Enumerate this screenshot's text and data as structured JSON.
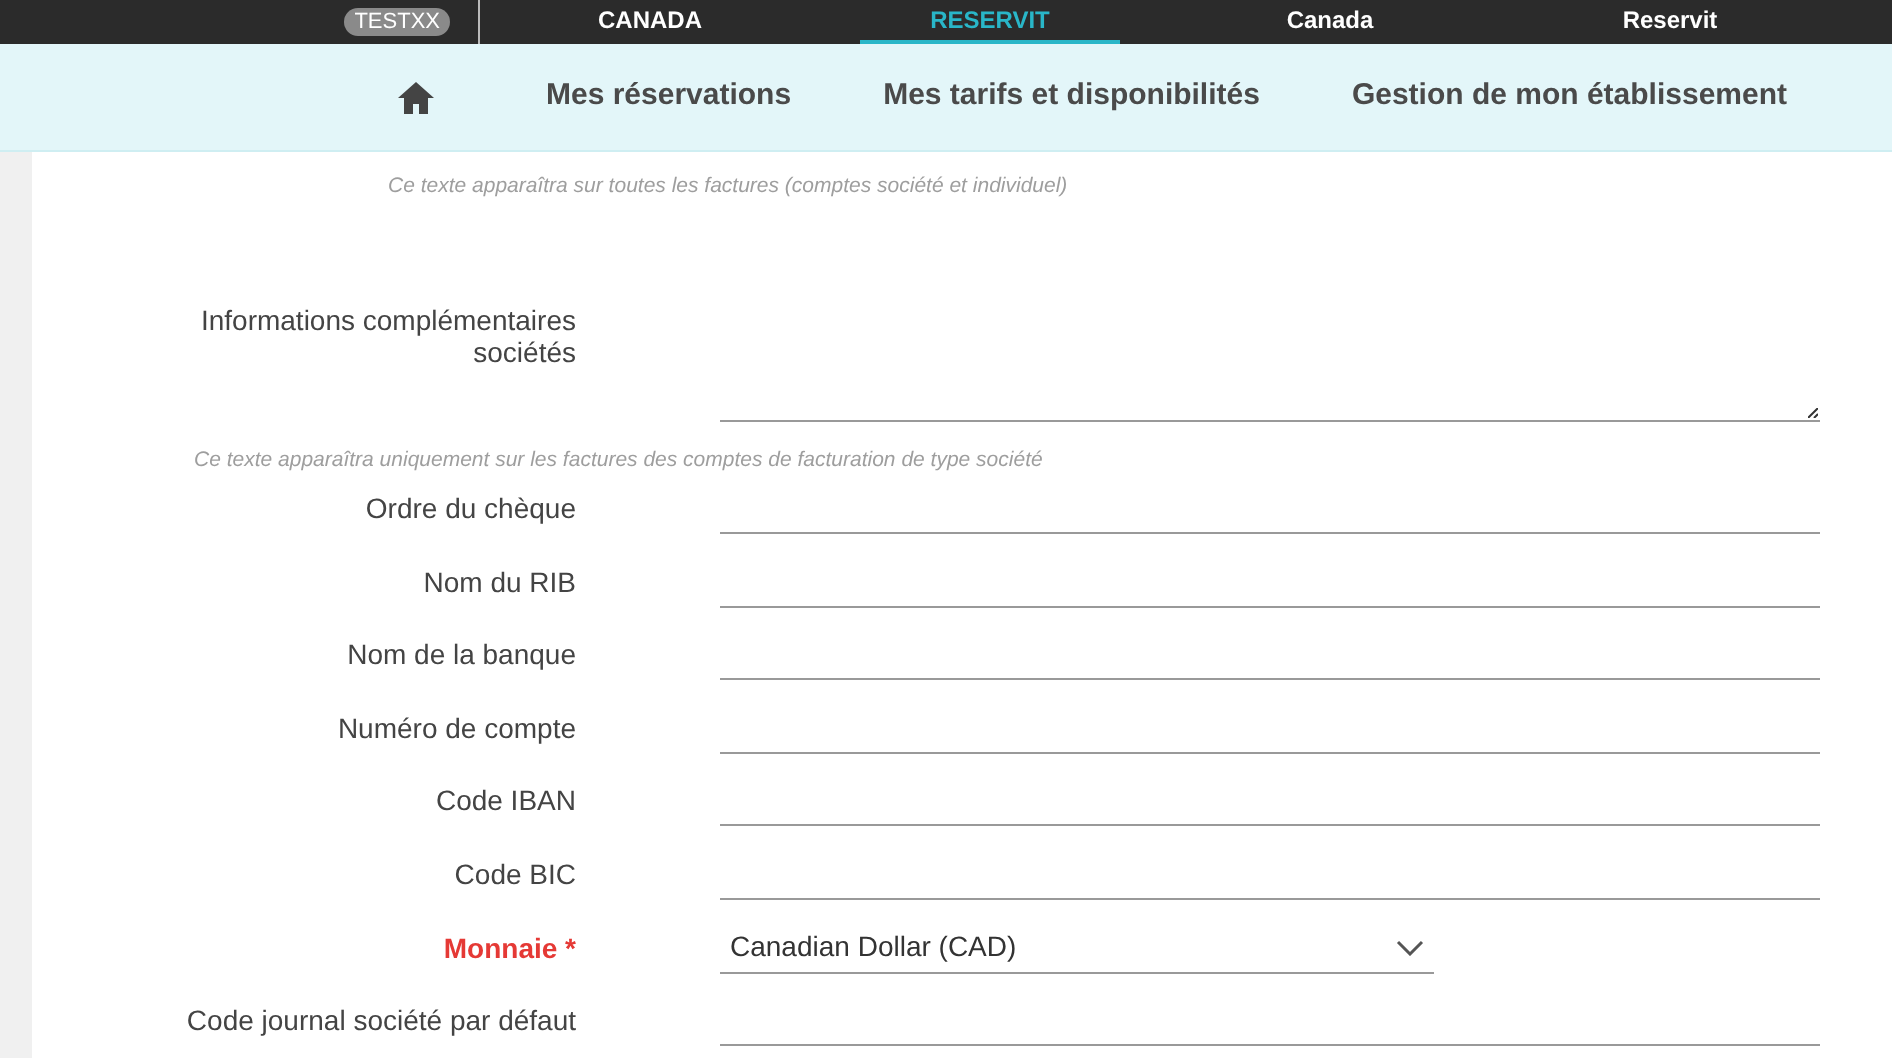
{
  "top_bar": {
    "badge": "TESTXX",
    "items": [
      {
        "label": "CANADA",
        "selected": false
      },
      {
        "label": "RESERVIT",
        "selected": true
      },
      {
        "label": "Canada",
        "selected": false
      },
      {
        "label": "Reservit",
        "selected": false
      }
    ]
  },
  "nav": {
    "items": [
      {
        "label": "Mes réservations"
      },
      {
        "label": "Mes tarifs et disponibilités"
      },
      {
        "label": "Gestion de mon établissement"
      }
    ]
  },
  "form": {
    "top_hint": "Ce texte apparaîtra sur toutes les factures (comptes société et individuel)",
    "fields": [
      {
        "kind": "textarea",
        "label": "Informations complémentaires sociétés",
        "required": false,
        "hint": "Ce texte apparaîtra uniquement sur les factures des comptes de facturation de type société"
      },
      {
        "kind": "text",
        "label": "Ordre du chèque",
        "required": false
      },
      {
        "kind": "text",
        "label": "Nom du RIB",
        "required": false
      },
      {
        "kind": "text",
        "label": "Nom de la banque",
        "required": false
      },
      {
        "kind": "text",
        "label": "Numéro de compte",
        "required": false
      },
      {
        "kind": "text",
        "label": "Code IBAN",
        "required": false
      },
      {
        "kind": "text",
        "label": "Code BIC",
        "required": false
      },
      {
        "kind": "select",
        "label": "Monnaie *",
        "required": true,
        "value": "Canadian Dollar (CAD)"
      },
      {
        "kind": "text",
        "label": "Code journal société par défaut",
        "required": false
      }
    ]
  }
}
